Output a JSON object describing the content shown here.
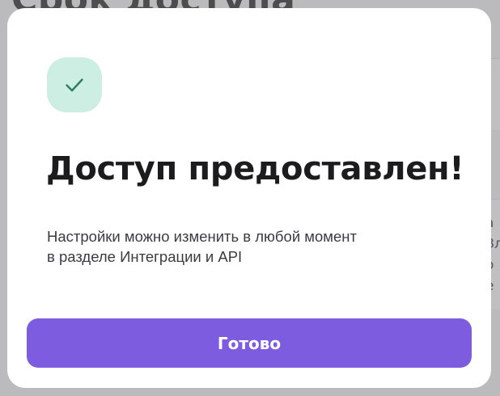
{
  "background": {
    "title": "Срок доступа",
    "right_fragments": [
      "а",
      "Зл",
      "о",
      "е"
    ]
  },
  "modal": {
    "icon": "check-icon",
    "icon_bg_color": "#cdeee3",
    "icon_color": "#2f7d62",
    "title": "Доступ предоставлен!",
    "description_lines": [
      "Настройки можно изменить в любой момент",
      "в разделе Интеграции и API"
    ],
    "button_label": "Готово",
    "button_color": "#7e5ce0"
  }
}
